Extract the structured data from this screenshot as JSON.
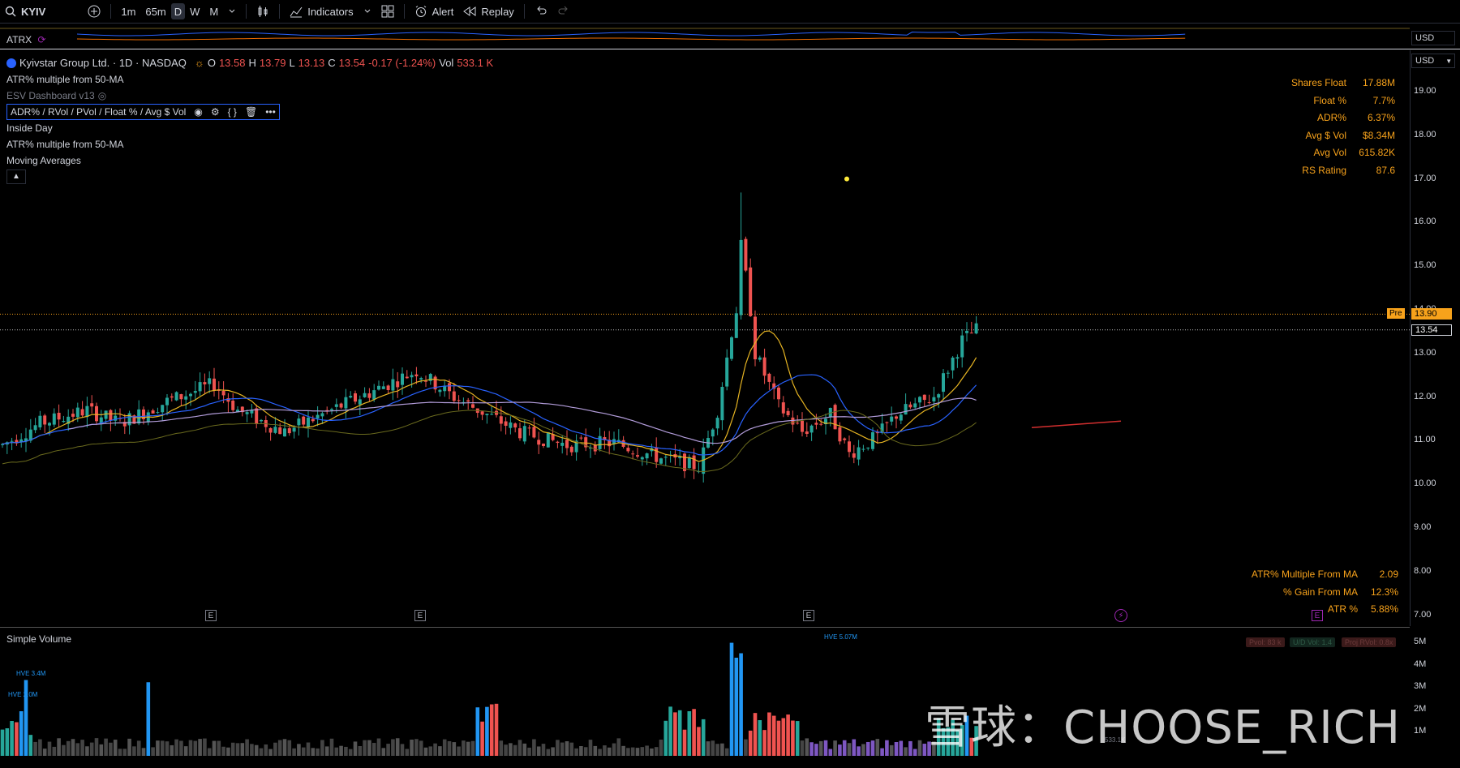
{
  "toolbar": {
    "symbol": "KYIV",
    "intervals": [
      "1m",
      "65m",
      "D",
      "W",
      "M"
    ],
    "selected_interval": "D",
    "indicators_label": "Indicators",
    "alert_label": "Alert",
    "replay_label": "Replay"
  },
  "atrx": {
    "label": "ATRX",
    "currency": "USD"
  },
  "header": {
    "name": "Kyivstar Group Ltd. · 1D · NASDAQ",
    "o_label": "O",
    "o": "13.58",
    "h_label": "H",
    "h": "13.79",
    "l_label": "L",
    "l": "13.13",
    "c_label": "C",
    "c": "13.54",
    "change": "-0.17 (-1.24%)",
    "vol_label": "Vol",
    "vol": "533.1 K"
  },
  "indicators": [
    "ATR% multiple from 50-MA",
    "ESV Dashboard v13",
    "ADR% / RVol / PVol / Float % / Avg $ Vol",
    "Inside Day",
    "ATR% multiple from 50-MA",
    "Moving Averages"
  ],
  "stats_top": [
    {
      "label": "Shares Float",
      "value": "17.88M"
    },
    {
      "label": "Float %",
      "value": "7.7%"
    },
    {
      "label": "ADR%",
      "value": "6.37%"
    },
    {
      "label": "Avg $ Vol",
      "value": "$8.34M"
    },
    {
      "label": "Avg Vol",
      "value": "615.82K"
    },
    {
      "label": "RS Rating",
      "value": "87.6"
    }
  ],
  "stats_bottom": [
    {
      "label": "ATR% Multiple From MA",
      "value": "2.09"
    },
    {
      "label": "% Gain From MA",
      "value": "12.3%"
    },
    {
      "label": "ATR %",
      "value": "5.88%"
    }
  ],
  "price_axis": {
    "currency": "USD",
    "ticks": [
      "19.00",
      "18.00",
      "17.00",
      "16.00",
      "15.00",
      "14.00",
      "13.00",
      "12.00",
      "11.00",
      "10.00",
      "9.00",
      "8.00",
      "7.00"
    ],
    "pre_label": "Pre",
    "pre_price": "13.90",
    "last_price": "13.54"
  },
  "volume": {
    "label": "Simple Volume",
    "ticks": [
      "5M",
      "4M",
      "3M",
      "2M",
      "1M"
    ],
    "hve_labels": [
      "HVE 3.4M",
      "HVE 2.0M",
      "HVE 5.07M"
    ],
    "badges": [
      "Pvol: 83 k",
      "U/D Vol: 1.4",
      "Proj RVol: 0.8x"
    ],
    "last_vol": "533.1K"
  },
  "events": [
    "E",
    "E",
    "E",
    "E"
  ],
  "watermark": "雪球：CHOOSE_RICH",
  "colors": {
    "up": "#26a69a",
    "down": "#ef5350",
    "vol_up": "#26a69a",
    "vol_down": "#ef5350",
    "accent": "#f7a21b",
    "hve": "#2196f3"
  }
}
